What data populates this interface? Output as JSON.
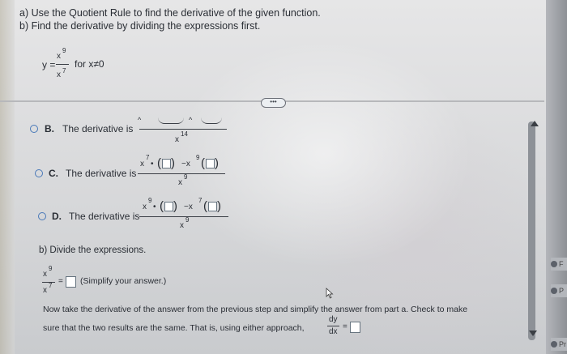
{
  "instructions": {
    "a": "a) Use the Quotient Rule to find the derivative of the given function.",
    "b": "b) Find the derivative by dividing the expressions first."
  },
  "function": {
    "lhs": "y =",
    "num_base": "x",
    "num_exp": "9",
    "den_base": "x",
    "den_exp": "7",
    "condition": "for x≠0"
  },
  "more_button": "•••",
  "options": [
    {
      "letter": "B.",
      "text": "The derivative is",
      "denominator": "x",
      "den_exp": "14"
    },
    {
      "letter": "C.",
      "text": "The derivative is",
      "left_base": "x",
      "left_exp": "7",
      "mid": "−x",
      "mid_exp": "9",
      "den_base": "x",
      "den_exp": "9"
    },
    {
      "letter": "D.",
      "text": "The derivative is",
      "left_base": "x",
      "left_exp": "9",
      "mid": "−x",
      "mid_exp": "7",
      "den_base": "x",
      "den_exp": "9"
    }
  ],
  "part_b": {
    "heading": "b) Divide the expressions.",
    "num_base": "x",
    "num_exp": "9",
    "den_base": "x",
    "den_exp": "7",
    "equals": "=",
    "hint": "(Simplify your answer.)"
  },
  "bottom": {
    "line1": "Now take the derivative of the answer from the previous step and simplify the answer from part a. Check to make",
    "line2": "sure that the two results are the same. That is, using either approach,",
    "dy": "dy",
    "dx": "dx",
    "equals": "="
  },
  "right_tags": [
    "F",
    "P",
    "Pr"
  ]
}
